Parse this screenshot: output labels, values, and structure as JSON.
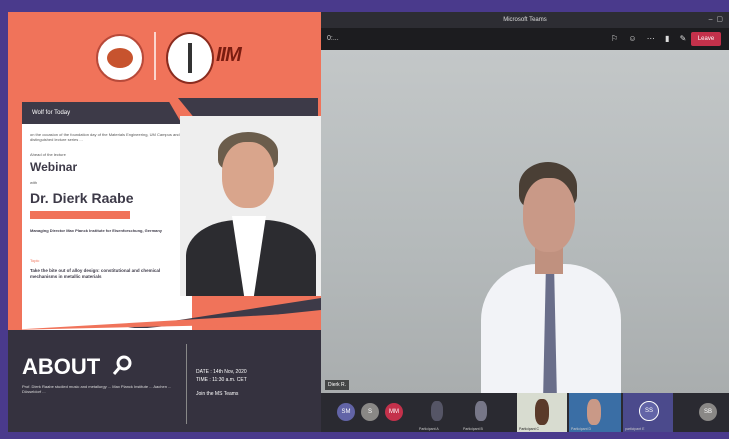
{
  "poster": {
    "header_bar": "Wolf  for Today",
    "intro_text": "on the occasion of the foundation day of the Materials Engineering, UM Campus and distinguished lecture series ...",
    "organized_by": "Ahead of the lecture",
    "webinar_label": "Webinar",
    "with_label": "with",
    "speaker_name": "Dr. Dierk Raabe",
    "speaker_role": "Managing Director Max Planck Institute for Eisenforschung, Germany",
    "topic_label": "Topic",
    "topic_text": "Take the bite out of alloy design: constitutional and chemical mechanisms in metallic materials",
    "about_label": "ABOUT",
    "about_text": "Prof. Dierk Raabe studied music and metallurgy ... Max Planck Institute ... Aachen ... Düsseldorf ...",
    "date_line": "DATE : 14th Nov, 2020",
    "time_line": "TIME : 11:30 a.m. CET",
    "venue_line": "Join the MS Teams"
  },
  "meeting": {
    "title": "Microsoft Teams",
    "timer": "0:...",
    "leave_label": "Leave",
    "presenter_tag": "Dierk R.",
    "participants": [
      {
        "initials": "SM",
        "color": "#6264a7",
        "label": ""
      },
      {
        "initials": "S",
        "color": "#8a8886",
        "label": ""
      },
      {
        "initials": "MM",
        "color": "#c4314b",
        "label": ""
      },
      {
        "initials": "",
        "color": "#444",
        "label": "Participant A"
      },
      {
        "initials": "",
        "color": "#444",
        "label": "Participant B"
      },
      {
        "initials": "",
        "color": "#444",
        "label": "Participant C"
      },
      {
        "initials": "",
        "color": "#444",
        "label": "Participant D"
      },
      {
        "initials": "SS",
        "color": "#6264a7",
        "label": "participant E"
      },
      {
        "initials": "SB",
        "color": "#8a8886",
        "label": ""
      }
    ]
  },
  "colors": {
    "frame": "#4a3a8c",
    "coral": "#f0735a",
    "navy": "#3d3a48",
    "leave": "#c4314b"
  }
}
